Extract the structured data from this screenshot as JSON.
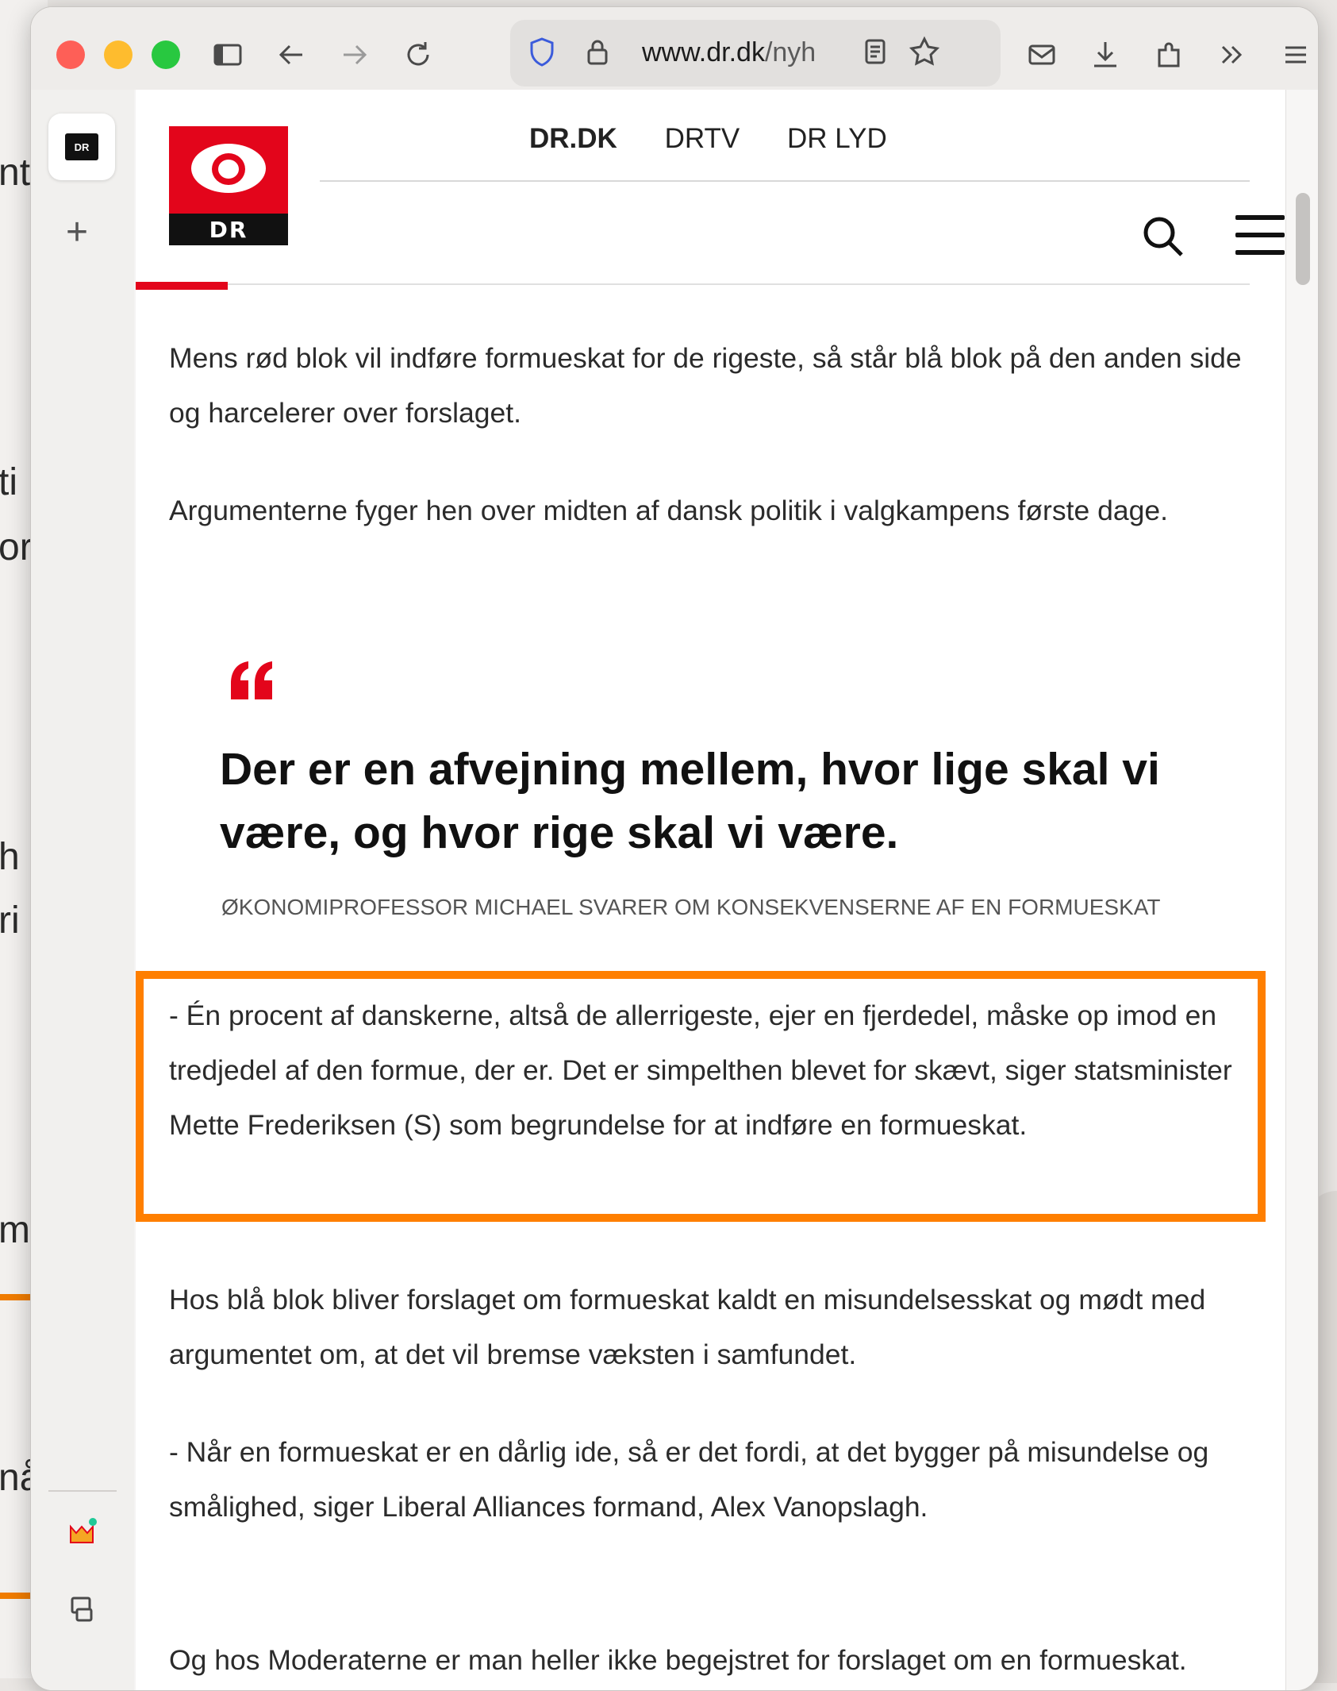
{
  "background": {
    "fragments": [
      "nt",
      "ti",
      "or",
      "h",
      "ri",
      "m",
      "nå"
    ]
  },
  "browser": {
    "url_domain": "www.dr.dk",
    "url_path": "/nyh",
    "sidebar_tab_label": "DR"
  },
  "site": {
    "logo_text": "DR",
    "nav": [
      "DR.DK",
      "DRTV",
      "DR LYD"
    ]
  },
  "article": {
    "p1": "Mens rød blok vil indføre formueskat for de rigeste, så står blå blok på den anden side og harcelerer over forslaget.",
    "p2": "Argumenterne fyger hen over midten af dansk politik i valgkampens første dage.",
    "quote": "Der er en afvejning mellem, hvor lige skal vi være, og hvor rige skal vi være.",
    "quote_source": "Økonomiprofessor Michael Svarer om konsekvenserne af en formueskat",
    "p3": "- Én procent af danskerne, altså de allerrigeste, ejer en fjerdedel, måske op imod en tredjedel af den formue, der er. Det er simpelthen blevet for skævt, siger statsminister Mette Frederiksen (S) som begrundelse for at indføre en formueskat.",
    "p4": "Hos blå blok bliver forslaget om formueskat kaldt en misundelsesskat og mødt med argumentet om, at det vil bremse væksten i samfundet.",
    "p5": "- Når en formueskat er en dårlig ide, så er det fordi, at det bygger på misundelse og smålighed, siger Liberal Alliances formand, Alex Vanopslagh.",
    "p6": "Og hos Moderaterne er man heller ikke begejstret for forslaget om en formueskat."
  },
  "colors": {
    "accent": "#e3051b",
    "highlight": "#ff7f00"
  }
}
